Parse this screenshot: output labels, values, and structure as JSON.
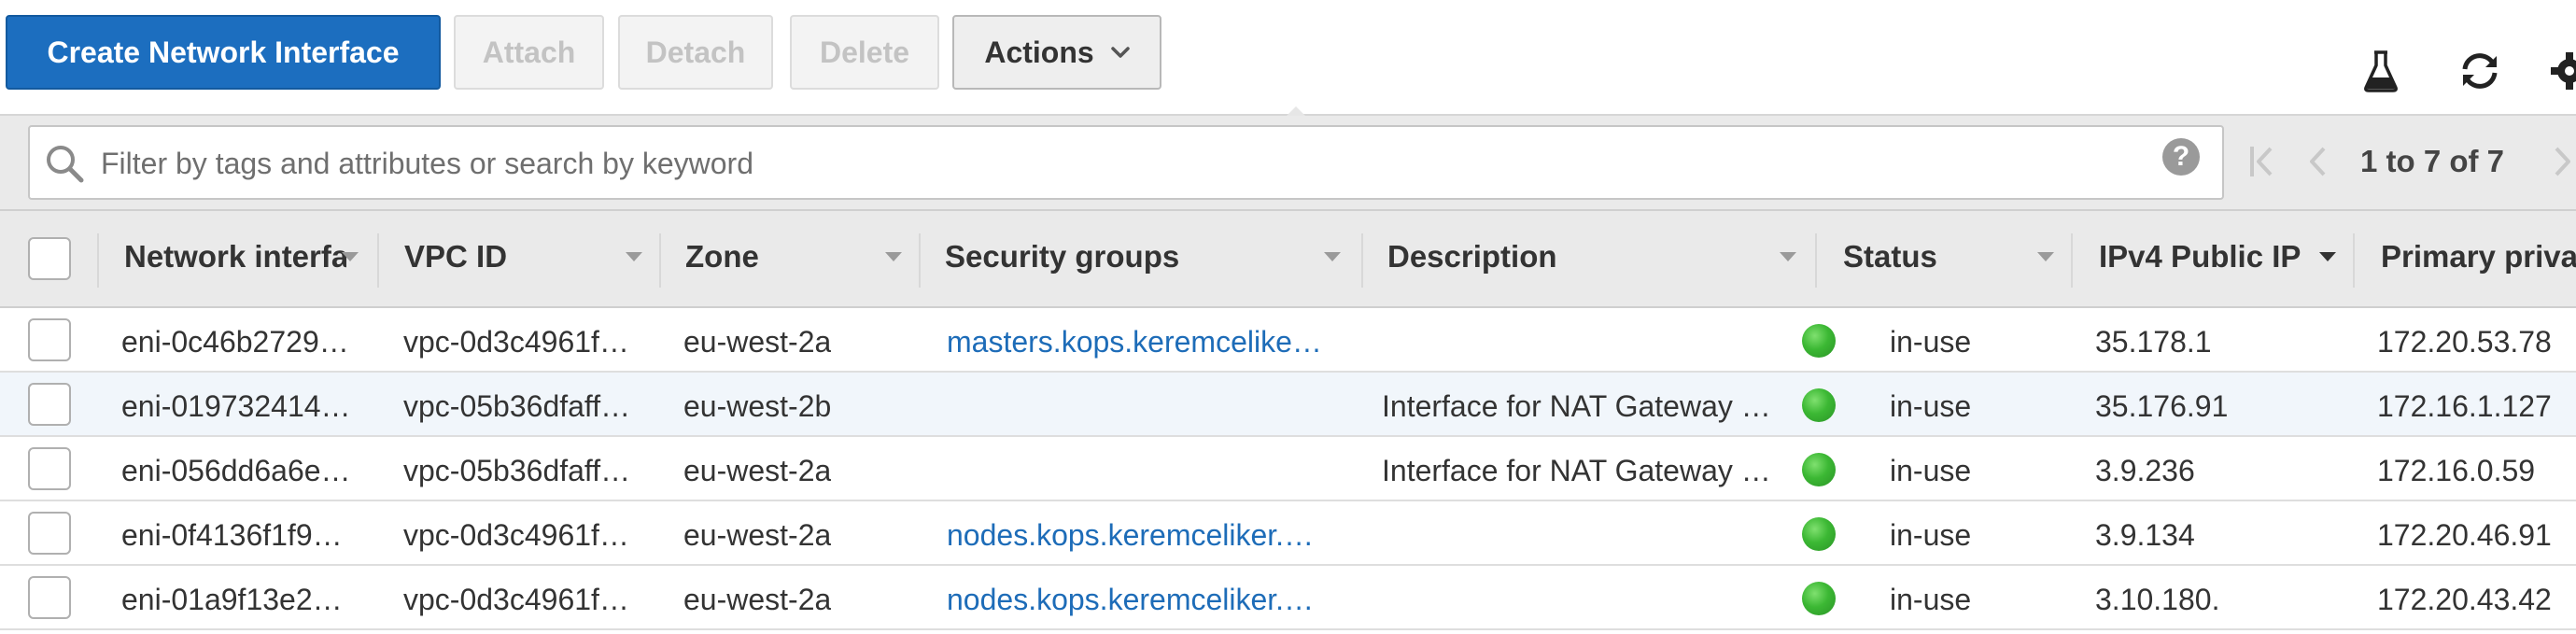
{
  "toolbar": {
    "create_label": "Create Network Interface",
    "attach_label": "Attach",
    "detach_label": "Detach",
    "delete_label": "Delete",
    "actions_label": "Actions",
    "icons": [
      "flask-icon",
      "refresh-icon",
      "gear-icon",
      "chevron-down-icon"
    ]
  },
  "filter": {
    "placeholder": "Filter by tags and attributes or search by keyword",
    "help_label": "?",
    "pagination": "1 to 7 of 7"
  },
  "columns": [
    "Network interfa",
    "VPC ID",
    "Zone",
    "Security groups",
    "Description",
    "Status",
    "IPv4 Public IP",
    "Primary privat"
  ],
  "rows": [
    {
      "eni": "eni-0c46b2729…",
      "vpc": "vpc-0d3c4961f…",
      "zone": "eu-west-2a",
      "sg": "masters.kops.keremcelike…",
      "desc": "",
      "status": "in-use",
      "ipv4": "35.178.1",
      "private": "172.20.53.78"
    },
    {
      "eni": "eni-019732414…",
      "vpc": "vpc-05b36dfaff…",
      "zone": "eu-west-2b",
      "sg": "",
      "desc": "Interface for NAT Gateway …",
      "status": "in-use",
      "ipv4": "35.176.91",
      "private": "172.16.1.127"
    },
    {
      "eni": "eni-056dd6a6e…",
      "vpc": "vpc-05b36dfaff…",
      "zone": "eu-west-2a",
      "sg": "",
      "desc": "Interface for NAT Gateway …",
      "status": "in-use",
      "ipv4": "3.9.236",
      "private": "172.16.0.59"
    },
    {
      "eni": "eni-0f4136f1f9…",
      "vpc": "vpc-0d3c4961f…",
      "zone": "eu-west-2a",
      "sg": "nodes.kops.keremceliker.…",
      "desc": "",
      "status": "in-use",
      "ipv4": "3.9.134",
      "private": "172.20.46.91"
    },
    {
      "eni": "eni-01a9f13e2…",
      "vpc": "vpc-0d3c4961f…",
      "zone": "eu-west-2a",
      "sg": "nodes.kops.keremceliker.…",
      "desc": "",
      "status": "in-use",
      "ipv4": "3.10.180.",
      "private": "172.20.43.42"
    }
  ],
  "colors": {
    "primary_button": "#1c6ebf",
    "link": "#1d6cb8",
    "status_in_use": "#3cb834",
    "selected_row": "#f1f6fb"
  }
}
